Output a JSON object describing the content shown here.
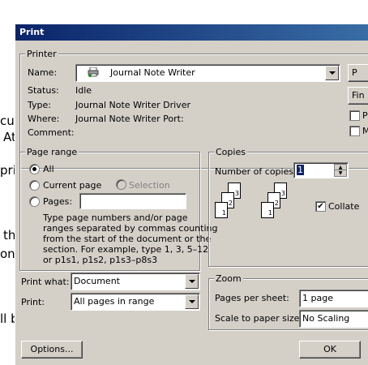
{
  "background_doc": {
    "fragments": [
      "cu",
      "At",
      "pri",
      "th",
      "on",
      "ll b"
    ]
  },
  "dialog": {
    "title": "Print",
    "printer": {
      "group_label": "Printer",
      "name_label": "Name:",
      "name_value": "Journal Note Writer",
      "status_label": "Status:",
      "status_value": "Idle",
      "type_label": "Type:",
      "type_value": "Journal Note Writer Driver",
      "where_label": "Where:",
      "where_value": "Journal Note Writer Port:",
      "comment_label": "Comment:",
      "properties_button": "P",
      "find_button": "Fin",
      "check1_label": "Pr",
      "check2_label": "M"
    },
    "page_range": {
      "group_label": "Page range",
      "all_label": "All",
      "current_label": "Current page",
      "selection_label": "Selection",
      "pages_label": "Pages:",
      "pages_value": "",
      "help_lines": [
        "Type page numbers and/or page",
        "ranges separated by commas counting",
        "from the start of the document or the",
        "section. For example, type 1, 3, 5–12",
        "or p1s1, p1s2, p1s3–p8s3"
      ]
    },
    "copies": {
      "group_label": "Copies",
      "number_label": "Number of copies:",
      "number_value": "1",
      "collate_label": "Collate",
      "collate_checked": true
    },
    "print_what_label": "Print what:",
    "print_what_value": "Document",
    "print_label": "Print:",
    "print_value": "All pages in range",
    "zoom": {
      "group_label": "Zoom",
      "pages_per_sheet_label": "Pages per sheet:",
      "pages_per_sheet_value": "1 page",
      "scale_label": "Scale to paper size:",
      "scale_value": "No Scaling"
    },
    "options_button": "Options...",
    "ok_button": "OK"
  }
}
